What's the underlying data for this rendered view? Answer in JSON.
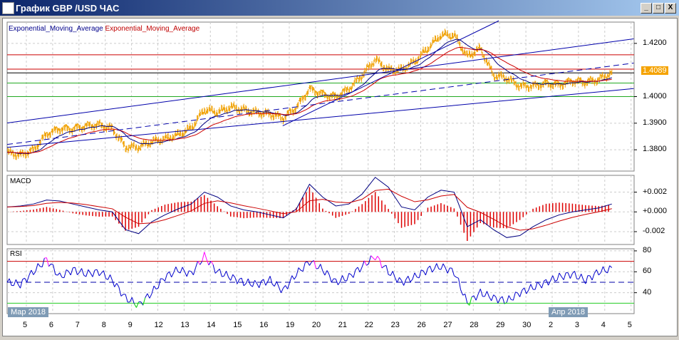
{
  "window": {
    "title": "График GBP /USD  ЧАС",
    "buttons": [
      "_",
      "□",
      "X"
    ]
  },
  "legend": {
    "ema1": "Exponential_Moving_Average",
    "ema2": "Exponential_Moving_Average",
    "ema1_color": "#00008b",
    "ema2_color": "#c00000"
  },
  "current_price": "1.4089",
  "colors": {
    "price": "#f0a000",
    "ema_fast": "#000080",
    "ema_slow": "#cc0000",
    "macd_hist": "#dd0000",
    "rsi": "#0000cc",
    "rsi_hot": "#ff00ff",
    "rsi_cold": "#00cc00"
  },
  "chart_data": [
    {
      "type": "line",
      "title": "GBP/USD price",
      "ylim": [
        1.372,
        1.428
      ],
      "yticks": [
        "1.4200",
        "1.4000",
        "1.3900",
        "1.3800"
      ],
      "ytick_values": [
        1.42,
        1.4,
        1.39,
        1.38
      ],
      "t_start": -0.73,
      "t_step": 0.5,
      "close": [
        1.379,
        1.378,
        1.38,
        1.386,
        1.388,
        1.388,
        1.389,
        1.3895,
        1.388,
        1.381,
        1.381,
        1.383,
        1.384,
        1.3855,
        1.388,
        1.395,
        1.394,
        1.396,
        1.395,
        1.394,
        1.3935,
        1.392,
        1.396,
        1.403,
        1.401,
        1.4,
        1.403,
        1.408,
        1.414,
        1.41,
        1.41,
        1.413,
        1.418,
        1.423,
        1.423,
        1.415,
        1.418,
        1.408,
        1.407,
        1.404,
        1.404,
        1.405,
        1.4045,
        1.406,
        1.4055,
        1.4065,
        1.4089
      ],
      "hlines": [
        {
          "value": 1.4157,
          "color": "#cc0000"
        },
        {
          "value": 1.4103,
          "color": "#cc0000"
        },
        {
          "value": 1.4089,
          "color": "#000000"
        },
        {
          "value": 1.4051,
          "color": "#22aa22"
        },
        {
          "value": 1.4,
          "color": "#22aa22"
        }
      ],
      "trendlines": [
        {
          "from": [
            -0.73,
            1.3901
          ],
          "to": [
            23.1,
            1.4217
          ],
          "dash": false
        },
        {
          "from": [
            -0.73,
            1.3809
          ],
          "to": [
            23.1,
            1.403
          ],
          "dash": false
        },
        {
          "from": [
            -0.73,
            1.382
          ],
          "to": [
            23.1,
            1.4126
          ],
          "dash": true
        },
        {
          "from": [
            9.75,
            1.389
          ],
          "to": [
            17.97,
            1.4285
          ],
          "dash": false
        }
      ]
    },
    {
      "type": "bar",
      "title": "MACD",
      "ylim": [
        -0.0033,
        0.0037
      ],
      "yticks": [
        "+0.002",
        "+0.000",
        "-0.002"
      ],
      "ytick_values": [
        0.002,
        0,
        -0.002
      ],
      "macd_milli": [
        0.5,
        0.6,
        0.8,
        1.2,
        1.1,
        0.8,
        0.5,
        0.2,
        0,
        -1.8,
        -2.2,
        -1,
        -0.3,
        0.3,
        0.8,
        2.0,
        1.5,
        0.6,
        0.2,
        0,
        -0.3,
        -0.6,
        0.3,
        2.8,
        1.5,
        0.6,
        0.8,
        1.8,
        3.5,
        2.5,
        0.5,
        0.2,
        1.5,
        2.2,
        2.0,
        -1.5,
        -0.8,
        -1.8,
        -2.6,
        -2.4,
        -1.5,
        -0.8,
        -0.3,
        0,
        0.2,
        0.4,
        0.8
      ]
    },
    {
      "type": "line",
      "title": "RSI",
      "ylim": [
        20,
        82
      ],
      "yticks": [
        "80",
        "60",
        "40"
      ],
      "ytick_values": [
        80,
        60,
        40
      ],
      "levels": [
        70,
        50,
        30
      ],
      "rsi": [
        50,
        48,
        60,
        72,
        55,
        62,
        58,
        60,
        52,
        35,
        28,
        40,
        55,
        62,
        58,
        75,
        60,
        55,
        50,
        48,
        52,
        42,
        58,
        70,
        62,
        50,
        55,
        65,
        75,
        60,
        50,
        55,
        62,
        65,
        60,
        30,
        40,
        35,
        32,
        40,
        45,
        50,
        55,
        58,
        52,
        60,
        63
      ]
    }
  ],
  "xaxis": {
    "labels": [
      "5",
      "6",
      "7",
      "8",
      "9",
      "12",
      "13",
      "14",
      "15",
      "16",
      "19",
      "20",
      "21",
      "22",
      "23",
      "26",
      "27",
      "28",
      "29",
      "30",
      "2",
      "3",
      "4",
      "5"
    ],
    "months": [
      "Мар 2018",
      "Апр 2018"
    ]
  }
}
